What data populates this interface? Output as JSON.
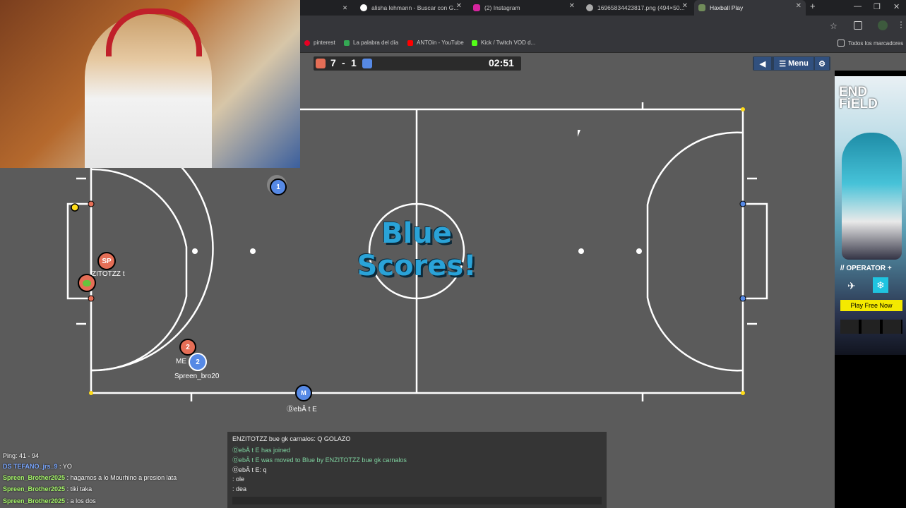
{
  "browser": {
    "tabs": [
      {
        "label": "alisha lehmann - Buscar con G..."
      },
      {
        "label": "(2) Instagram"
      },
      {
        "label": "16965834423817.png (494×50..."
      },
      {
        "label": "Haxball Play"
      }
    ],
    "new_tab": "+",
    "bookmarks": [
      {
        "label": "pinterest"
      },
      {
        "label": "La palabra del día"
      },
      {
        "label": "ANTOin - YouTube"
      },
      {
        "label": "Kick / Twitch VOD d..."
      }
    ],
    "all_bookmarks": "Todos los marcadores"
  },
  "game": {
    "red_score": "7",
    "separator": "-",
    "blue_score": "1",
    "timer": "02:51",
    "menu_label": "Menu",
    "banner_line1": "Blue",
    "banner_line2": "Scores!",
    "players": [
      {
        "label": "1",
        "team": "blue"
      },
      {
        "label": "SP",
        "team": "red"
      },
      {
        "label": "2",
        "team": "red"
      },
      {
        "label": "2",
        "team": "blue"
      },
      {
        "label": "M",
        "team": "blue"
      }
    ],
    "names": {
      "enzi": "ZITOTZZ t",
      "me": "ME",
      "spreen": "Spreen_bro20",
      "debate": "ⒹebÂ t E"
    },
    "ping": "Ping: 41 - 94",
    "colors": {
      "red": "#e56e56",
      "blue": "#5689e5",
      "field": "#718c5a",
      "pitch_line": "#c7e6bd"
    }
  },
  "chat": {
    "lines": [
      {
        "text": "ENZITOTZZ bue gk carnalos: Q GOLAZO",
        "type": "msg"
      },
      {
        "text": "ⒹebÂ t E has joined",
        "type": "sys"
      },
      {
        "text": "ⒹebÂ t E was moved to Blue by ENZITOTZZ bue gk carnalos",
        "type": "sys"
      },
      {
        "text": "ⒹebÂ t E: q",
        "type": "msg"
      },
      {
        "text": ": ole",
        "type": "msg"
      },
      {
        "text": ": dea",
        "type": "msg"
      }
    ]
  },
  "stream_chat": [
    {
      "user": "DS TEFANO_jrs_9",
      "text": ": YO"
    },
    {
      "user": "Spreen_Brother2025",
      "text": ": hagamos a lo Mourhino a presion lata"
    },
    {
      "user": "Spreen_Brother2025",
      "text": ": tiki taka"
    },
    {
      "user": "Spreen_Brother2025",
      "text": ": a los dos"
    }
  ],
  "ad": {
    "logo": "END FiELD",
    "operator": "// OPERATOR +",
    "cta": "Play Free Now"
  }
}
